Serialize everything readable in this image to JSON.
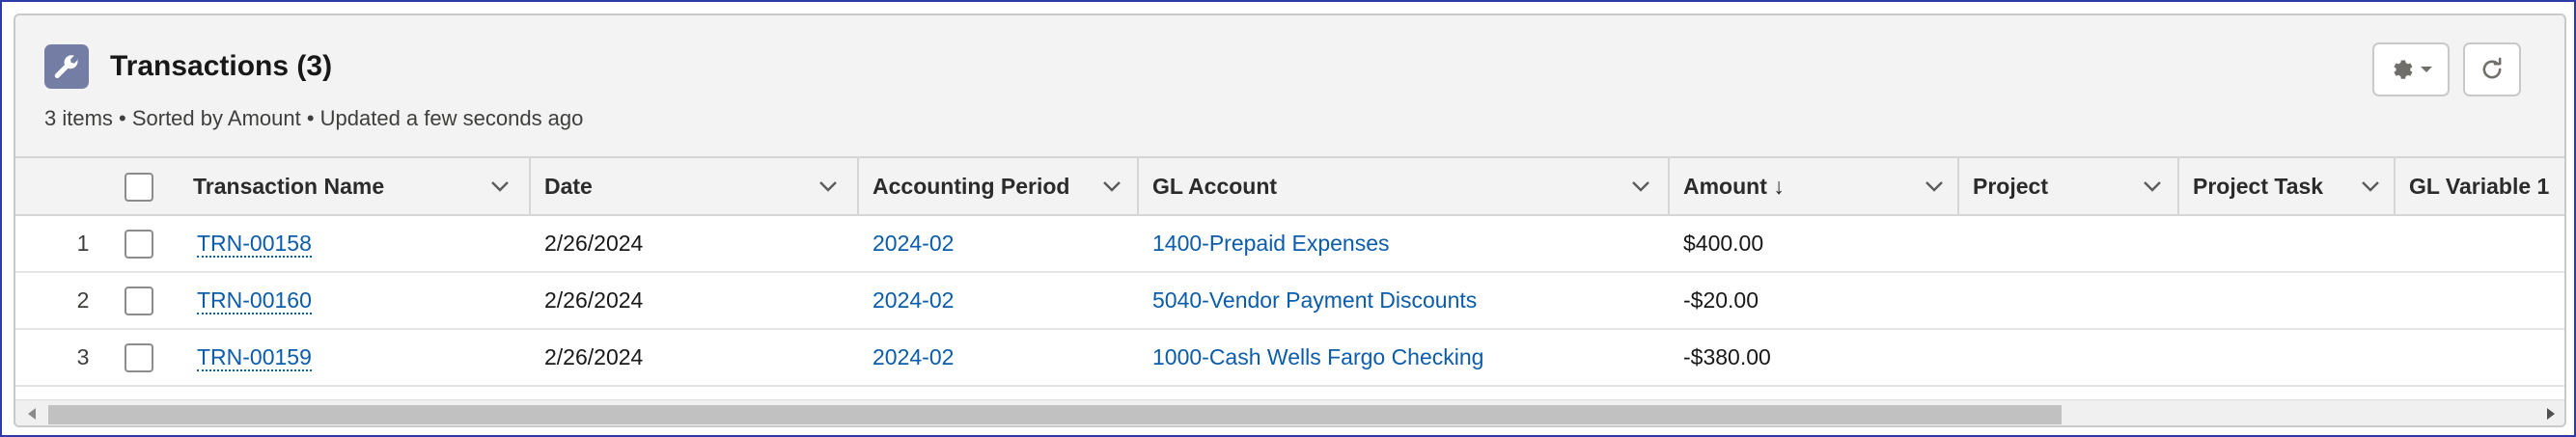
{
  "header": {
    "icon": "wrench-icon",
    "title": "Transactions (3)",
    "subtitle": "3 items • Sorted by Amount • Updated a few seconds ago",
    "icon_bg": "#747da3"
  },
  "toolbar": {
    "settings_icon": "gear-icon",
    "refresh_icon": "refresh-icon"
  },
  "table": {
    "columns": [
      {
        "label": "Transaction Name"
      },
      {
        "label": "Date"
      },
      {
        "label": "Accounting Period"
      },
      {
        "label": "GL Account"
      },
      {
        "label": "Amount ↓"
      },
      {
        "label": "Project"
      },
      {
        "label": "Project Task"
      },
      {
        "label": "GL Variable 1"
      }
    ],
    "rows": [
      {
        "num": "1",
        "name": "TRN-00158",
        "date": "2/26/2024",
        "period": "2024-02",
        "gl_account": "1400-Prepaid Expenses",
        "amount": "$400.00"
      },
      {
        "num": "2",
        "name": "TRN-00160",
        "date": "2/26/2024",
        "period": "2024-02",
        "gl_account": "5040-Vendor Payment Discounts",
        "amount": "-$20.00"
      },
      {
        "num": "3",
        "name": "TRN-00159",
        "date": "2/26/2024",
        "period": "2024-02",
        "gl_account": "1000-Cash Wells Fargo Checking",
        "amount": "-$380.00"
      }
    ]
  },
  "colors": {
    "link": "#0b5cab",
    "header_bg": "#f3f3f3",
    "border": "#c9c9c9"
  }
}
